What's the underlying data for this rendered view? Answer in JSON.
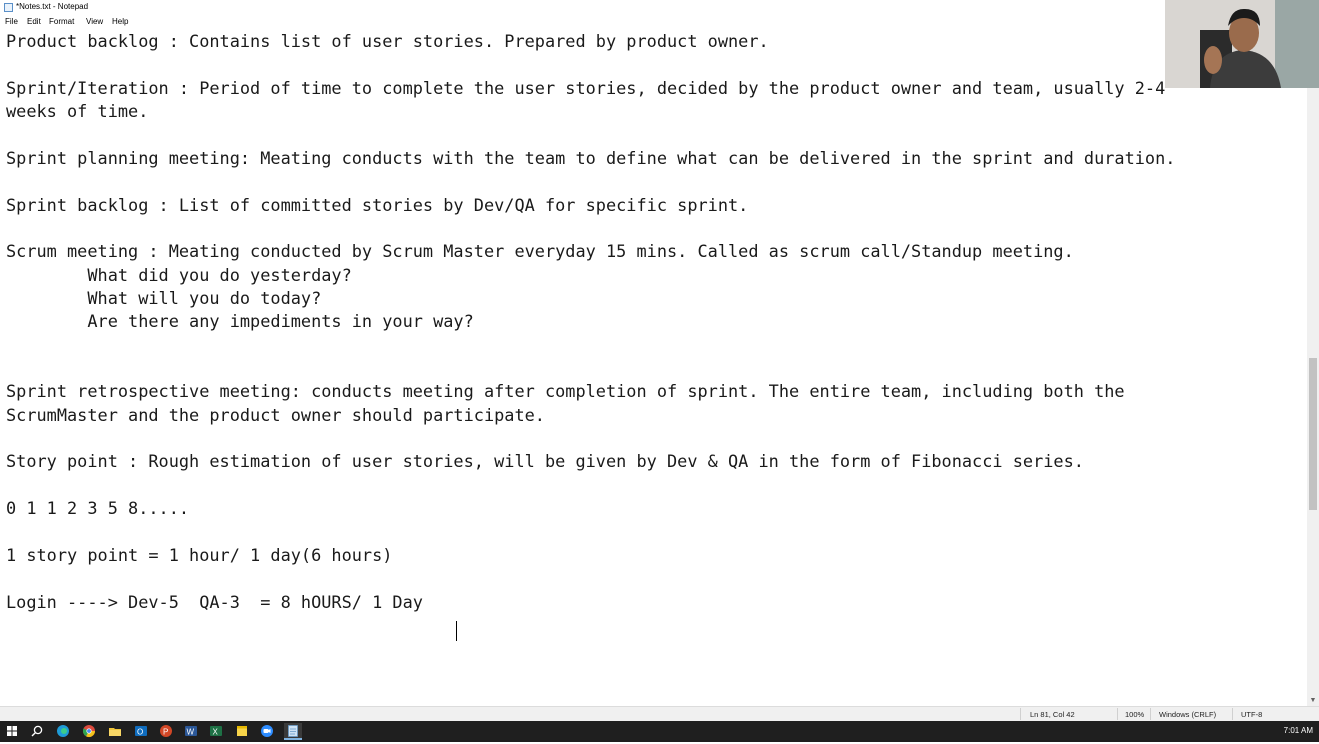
{
  "window": {
    "title": "*Notes.txt - Notepad"
  },
  "menu": {
    "items": [
      "File",
      "Edit",
      "Format",
      "View",
      "Help"
    ]
  },
  "editor": {
    "lines": [
      "Product backlog : Contains list of user stories. Prepared by product owner.",
      "",
      "Sprint/Iteration : Period of time to complete the user stories, decided by the product owner and team, usually 2-4",
      "weeks of time.",
      "",
      "Sprint planning meeting: Meating conducts with the team to define what can be delivered in the sprint and duration.",
      "",
      "Sprint backlog : List of committed stories by Dev/QA for specific sprint.",
      "",
      "Scrum meeting : Meating conducted by Scrum Master everyday 15 mins. Called as scrum call/Standup meeting.",
      "        What did you do yesterday?",
      "        What will you do today?",
      "        Are there any impediments in your way?",
      "",
      "",
      "Sprint retrospective meeting: conducts meeting after completion of sprint. The entire team, including both the",
      "ScrumMaster and the product owner should participate.",
      "",
      "Story point : Rough estimation of user stories, will be given by Dev & QA in the form of Fibonacci series.",
      "",
      "0 1 1 2 3 5 8.....",
      "",
      "1 story point = 1 hour/ 1 day(6 hours)",
      "",
      "Login ----> Dev-5  QA-3  = 8 hOURS/ 1 Day"
    ]
  },
  "statusbar": {
    "position": "Ln 81, Col 42",
    "zoom": "100%",
    "line_ending": "Windows (CRLF)",
    "encoding": "UTF-8"
  },
  "taskbar": {
    "icons": [
      "windows-start-icon",
      "search-icon",
      "edge-icon",
      "chrome-icon",
      "file-explorer-icon",
      "outlook-icon",
      "powerpoint-icon",
      "word-icon",
      "excel-icon",
      "sticky-notes-icon",
      "zoom-icon",
      "notepad-icon"
    ],
    "clock": "7:01 AM"
  }
}
